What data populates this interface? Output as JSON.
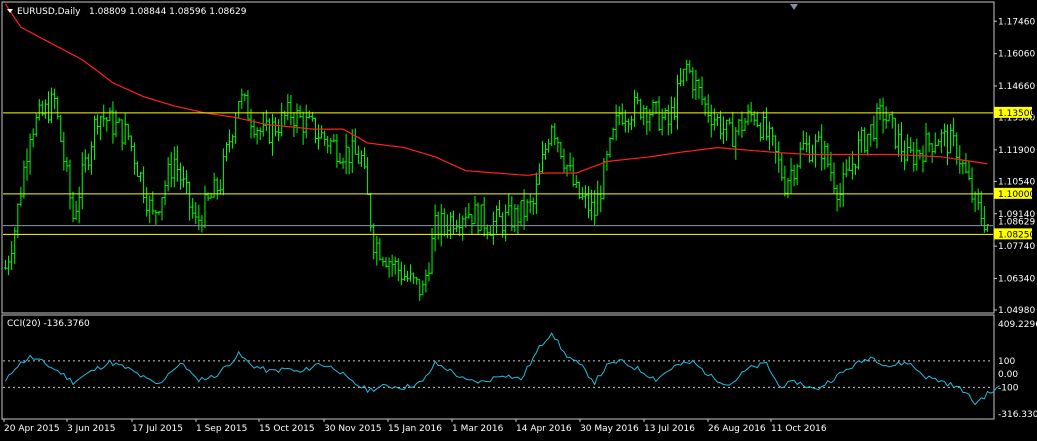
{
  "chart_data": [
    {
      "type": "bar",
      "title": "EURUSD,Daily",
      "ohlc_header": "1.08809 1.08844 1.08596 1.08629",
      "ylim": [
        1.0498,
        1.1786
      ],
      "y_ticks": [
        "1.17460",
        "1.16060",
        "1.14660",
        "1.13300",
        "1.11900",
        "1.10540",
        "1.09140",
        "1.07740",
        "1.06340",
        "1.04980"
      ],
      "y_tick_values": [
        1.1746,
        1.1606,
        1.1466,
        1.133,
        1.119,
        1.1054,
        1.0914,
        1.0774,
        1.0634,
        1.0498
      ],
      "x_ticks": [
        "20 Apr 2015",
        "3 Jun 2015",
        "17 Jul 2015",
        "1 Sep 2015",
        "15 Oct 2015",
        "30 Nov 2015",
        "15 Jan 2016",
        "1 Mar 2016",
        "14 Apr 2016",
        "30 May 2016",
        "13 Jul 2016",
        "26 Aug 2016",
        "11 Oct 2016"
      ],
      "horizontal_levels": [
        {
          "label": "1.13500",
          "value": 1.135,
          "color": "#ffff00"
        },
        {
          "label": "1.10000",
          "value": 1.1,
          "color": "#ffff00"
        },
        {
          "label": "1.08250",
          "value": 1.0825,
          "color": "#ffff00"
        }
      ],
      "current_price": {
        "label": "1.08629",
        "value": 1.08629,
        "color": "#8899aa"
      },
      "bar_color": "#00ff00",
      "ma_color": "#ff2020",
      "close_anchors": [
        [
          0,
          1.068
        ],
        [
          3,
          1.085
        ],
        [
          8,
          1.128
        ],
        [
          16,
          1.14
        ],
        [
          22,
          1.09
        ],
        [
          30,
          1.135
        ],
        [
          40,
          1.125
        ],
        [
          48,
          1.09
        ],
        [
          55,
          1.115
        ],
        [
          62,
          1.087
        ],
        [
          70,
          1.105
        ],
        [
          76,
          1.142
        ],
        [
          84,
          1.125
        ],
        [
          93,
          1.135
        ],
        [
          100,
          1.128
        ],
        [
          108,
          1.12
        ],
        [
          116,
          1.115
        ],
        [
          120,
          1.08
        ],
        [
          126,
          1.07
        ],
        [
          132,
          1.062
        ],
        [
          136,
          1.058
        ],
        [
          140,
          1.085
        ],
        [
          150,
          1.093
        ],
        [
          158,
          1.087
        ],
        [
          166,
          1.09
        ],
        [
          172,
          1.095
        ],
        [
          178,
          1.132
        ],
        [
          186,
          1.1
        ],
        [
          192,
          1.092
        ],
        [
          200,
          1.135
        ],
        [
          208,
          1.138
        ],
        [
          216,
          1.13
        ],
        [
          222,
          1.155
        ],
        [
          228,
          1.138
        ],
        [
          236,
          1.125
        ],
        [
          244,
          1.135
        ],
        [
          250,
          1.12
        ],
        [
          254,
          1.105
        ],
        [
          260,
          1.12
        ],
        [
          266,
          1.12
        ],
        [
          272,
          1.1
        ],
        [
          278,
          1.12
        ],
        [
          286,
          1.135
        ],
        [
          294,
          1.115
        ],
        [
          304,
          1.125
        ],
        [
          310,
          1.12
        ],
        [
          316,
          1.095
        ],
        [
          320,
          1.087
        ]
      ],
      "ma_anchors": [
        [
          0,
          1.182
        ],
        [
          5,
          1.172
        ],
        [
          15,
          1.165
        ],
        [
          25,
          1.158
        ],
        [
          35,
          1.148
        ],
        [
          45,
          1.142
        ],
        [
          55,
          1.138
        ],
        [
          65,
          1.135
        ],
        [
          75,
          1.133
        ],
        [
          85,
          1.13
        ],
        [
          100,
          1.128
        ],
        [
          110,
          1.128
        ],
        [
          118,
          1.122
        ],
        [
          130,
          1.12
        ],
        [
          140,
          1.116
        ],
        [
          150,
          1.11
        ],
        [
          160,
          1.109
        ],
        [
          170,
          1.108
        ],
        [
          176,
          1.109
        ],
        [
          186,
          1.109
        ],
        [
          196,
          1.114
        ],
        [
          210,
          1.116
        ],
        [
          220,
          1.118
        ],
        [
          232,
          1.12
        ],
        [
          250,
          1.118
        ],
        [
          262,
          1.117
        ],
        [
          276,
          1.117
        ],
        [
          290,
          1.117
        ],
        [
          305,
          1.116
        ],
        [
          315,
          1.114
        ],
        [
          320,
          1.113
        ]
      ]
    },
    {
      "type": "line",
      "title": "CCI(20) -136.3760",
      "ylim": [
        -316.3306,
        409.2296
      ],
      "y_ticks": [
        "409.2296",
        "100",
        "0.00",
        "-100",
        "-316.3306"
      ],
      "y_tick_values": [
        409.2296,
        100,
        0,
        -100,
        -316.3306
      ],
      "levels": [
        100,
        -100
      ],
      "line_color": "#22bbdd",
      "anchors": [
        [
          0,
          -60
        ],
        [
          3,
          50
        ],
        [
          8,
          130
        ],
        [
          12,
          90
        ],
        [
          18,
          10
        ],
        [
          22,
          -60
        ],
        [
          28,
          20
        ],
        [
          34,
          90
        ],
        [
          40,
          40
        ],
        [
          46,
          -40
        ],
        [
          50,
          -80
        ],
        [
          54,
          30
        ],
        [
          58,
          80
        ],
        [
          62,
          -40
        ],
        [
          68,
          -20
        ],
        [
          72,
          60
        ],
        [
          76,
          150
        ],
        [
          80,
          70
        ],
        [
          86,
          20
        ],
        [
          92,
          40
        ],
        [
          96,
          10
        ],
        [
          102,
          80
        ],
        [
          108,
          40
        ],
        [
          112,
          -50
        ],
        [
          118,
          -120
        ],
        [
          124,
          -90
        ],
        [
          130,
          -100
        ],
        [
          136,
          -60
        ],
        [
          140,
          80
        ],
        [
          144,
          40
        ],
        [
          150,
          -50
        ],
        [
          156,
          -60
        ],
        [
          162,
          0
        ],
        [
          168,
          -40
        ],
        [
          174,
          200
        ],
        [
          178,
          320
        ],
        [
          182,
          160
        ],
        [
          188,
          50
        ],
        [
          192,
          -60
        ],
        [
          196,
          60
        ],
        [
          200,
          100
        ],
        [
          206,
          40
        ],
        [
          212,
          -40
        ],
        [
          218,
          60
        ],
        [
          224,
          90
        ],
        [
          230,
          -20
        ],
        [
          236,
          -80
        ],
        [
          242,
          40
        ],
        [
          248,
          80
        ],
        [
          252,
          -90
        ],
        [
          258,
          -60
        ],
        [
          264,
          -120
        ],
        [
          270,
          -30
        ],
        [
          276,
          60
        ],
        [
          282,
          130
        ],
        [
          288,
          60
        ],
        [
          294,
          90
        ],
        [
          300,
          -20
        ],
        [
          306,
          -60
        ],
        [
          312,
          -120
        ],
        [
          316,
          -220
        ],
        [
          320,
          -150
        ],
        [
          324,
          -100
        ]
      ]
    }
  ]
}
